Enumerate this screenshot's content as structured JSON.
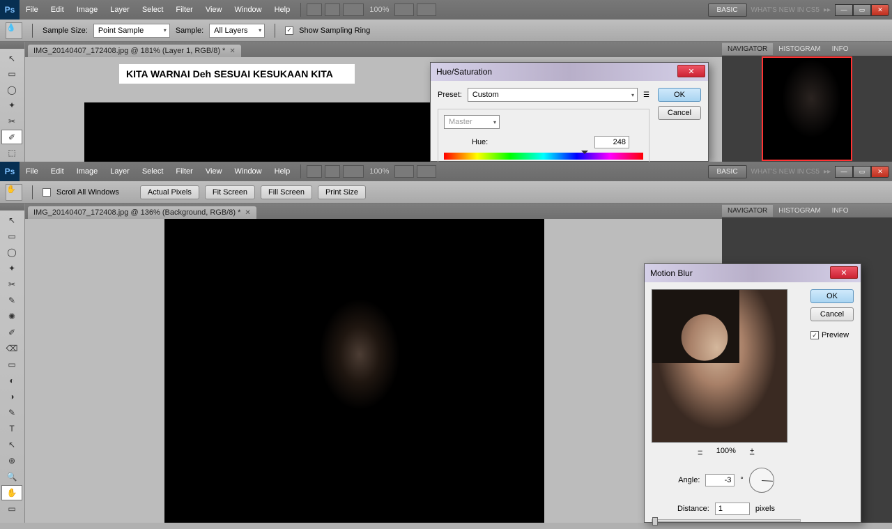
{
  "app": {
    "logo": "Ps"
  },
  "menus": [
    "File",
    "Edit",
    "Image",
    "Layer",
    "Select",
    "Filter",
    "View",
    "Window",
    "Help"
  ],
  "menubar": {
    "zoom": "100%",
    "arrow": "▸▸",
    "basic": "BASIC",
    "whats_new": "WHAT'S NEW IN CS5"
  },
  "optbar_top": {
    "sample_size_lbl": "Sample Size:",
    "sample_size_val": "Point Sample",
    "sample_lbl": "Sample:",
    "sample_val": "All Layers",
    "show_ring": "Show Sampling Ring"
  },
  "optbar_bottom": {
    "scroll_all": "Scroll All Windows",
    "b1": "Actual Pixels",
    "b2": "Fit Screen",
    "b3": "Fill Screen",
    "b4": "Print Size"
  },
  "tab_top": "IMG_20140407_172408.jpg @ 181% (Layer 1, RGB/8) *",
  "tab_bottom": "IMG_20140407_172408.jpg @ 136% (Background, RGB/8) *",
  "panel_tabs": {
    "nav": "NAVIGATOR",
    "hist": "HISTOGRAM",
    "info": "INFO"
  },
  "caption": "KITA WARNAI Deh SESUAI KESUKAAN KITA",
  "hue_dialog": {
    "title": "Hue/Saturation",
    "preset_lbl": "Preset:",
    "preset_val": "Custom",
    "channel": "Master",
    "hue_lbl": "Hue:",
    "hue_val": "248",
    "ok": "OK",
    "cancel": "Cancel"
  },
  "motion_dialog": {
    "title": "Motion Blur",
    "ok": "OK",
    "cancel": "Cancel",
    "preview": "Preview",
    "zoom": "100%",
    "angle_lbl": "Angle:",
    "angle_val": "-3",
    "deg": "°",
    "dist_lbl": "Distance:",
    "dist_val": "1",
    "dist_unit": "pixels"
  },
  "tool_glyphs_top": [
    "↖",
    "▭",
    "◯",
    "✦",
    "✂",
    "✐",
    "⬚"
  ],
  "tool_glyphs_bottom": [
    "↖",
    "▭",
    "◯",
    "✦",
    "✂",
    "✎",
    "✺",
    "✐",
    "⌫",
    "▭",
    "◐",
    "◑",
    "✎",
    "T",
    "↖",
    "⊕",
    "🔍",
    "✋",
    "▭"
  ]
}
